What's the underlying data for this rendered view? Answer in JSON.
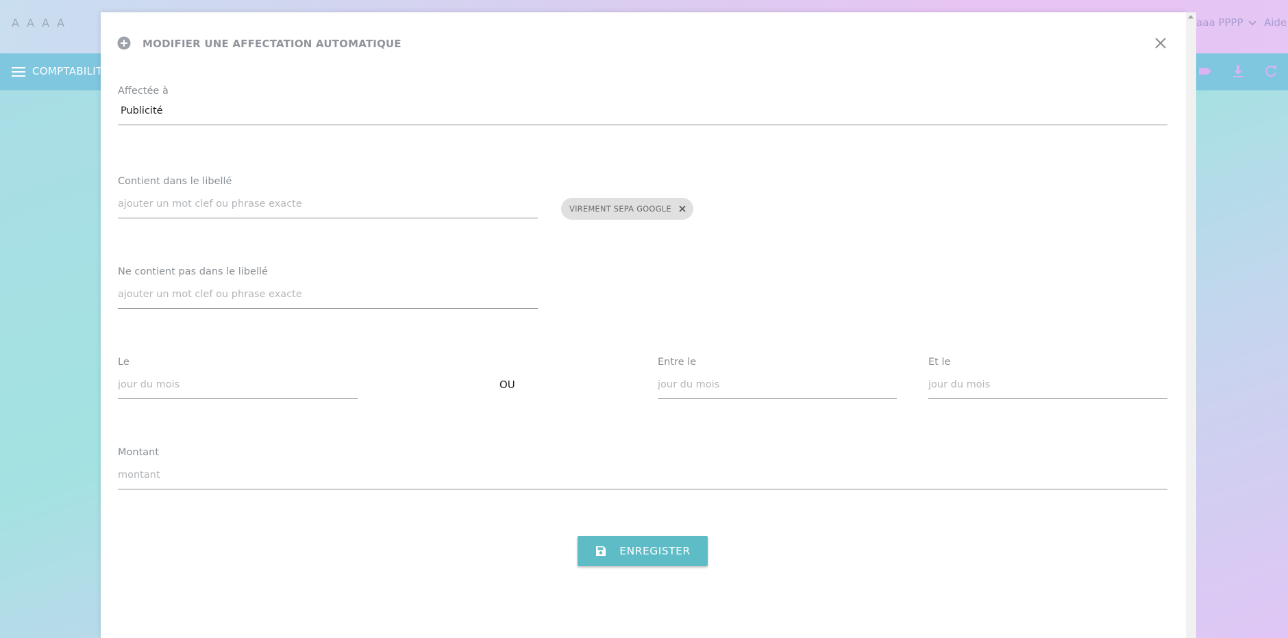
{
  "app": {
    "brand": "A A A A",
    "user_name": "aaa PPPP",
    "help_label": "Aide"
  },
  "navbar": {
    "title": "COMPTABILIT",
    "icons": [
      "menu-icon",
      "tag-icon",
      "download-icon",
      "refresh-icon"
    ]
  },
  "modal": {
    "title": "MODIFIER UNE AFFECTATION AUTOMATIQUE",
    "assigned_to": {
      "label": "Affectée à",
      "value": "Publicité"
    },
    "contains": {
      "label": "Contient dans le libellé",
      "placeholder": "ajouter un mot clef ou phrase exacte",
      "chips": [
        "VIREMENT SEPA GOOGLE"
      ]
    },
    "not_contains": {
      "label": "Ne contient pas dans le libellé",
      "placeholder": "ajouter un mot clef ou phrase exacte"
    },
    "day": {
      "label": "Le",
      "placeholder": "jour du mois"
    },
    "or_label": "OU",
    "between": {
      "label": "Entre le",
      "placeholder": "jour du mois"
    },
    "and": {
      "label": "Et le",
      "placeholder": "jour du mois"
    },
    "amount": {
      "label": "Montant",
      "placeholder": "montant"
    },
    "save_label": "ENREGISTER"
  },
  "colors": {
    "navbar": "#7fc6df",
    "button": "#5dbcc6",
    "chip": "#e0e0e0"
  }
}
